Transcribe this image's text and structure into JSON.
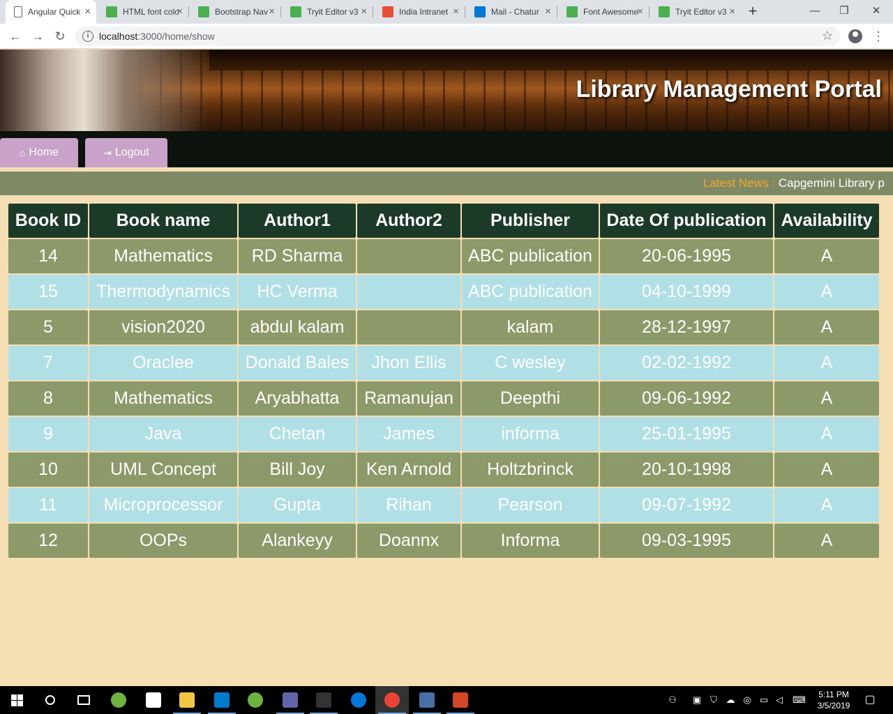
{
  "browser": {
    "tabs": [
      {
        "title": "Angular Quick",
        "icon": "document-icon",
        "color": "#5f6368",
        "active": true
      },
      {
        "title": "HTML font color",
        "icon": "w3schools-icon",
        "color": "#4caf50"
      },
      {
        "title": "Bootstrap Nav",
        "icon": "w3schools-icon",
        "color": "#4caf50"
      },
      {
        "title": "Tryit Editor v3",
        "icon": "w3schools-icon",
        "color": "#4caf50"
      },
      {
        "title": "India Intranet",
        "icon": "t-icon",
        "color": "#e94e36"
      },
      {
        "title": "Mail - Chatur",
        "icon": "outlook-icon",
        "color": "#0078d4"
      },
      {
        "title": "Font Awesome",
        "icon": "w3schools-icon",
        "color": "#4caf50"
      },
      {
        "title": "Tryit Editor v3",
        "icon": "w3schools-icon",
        "color": "#4caf50"
      }
    ],
    "new_tab": "+",
    "minimize": "—",
    "restore": "❐",
    "close": "✕",
    "back": "←",
    "forward": "→",
    "reload": "↻",
    "url_host": "localhost",
    "url_rest": ":3000/home/show"
  },
  "page": {
    "banner_title": "Library Management Portal",
    "nav": {
      "home": "Home",
      "logout": "Logout"
    },
    "news": {
      "label": "Latest News :",
      "text": "Capgemini Library p"
    },
    "table": {
      "headers": [
        "Book ID",
        "Book name",
        "Author1",
        "Author2",
        "Publisher",
        "Date Of publication",
        "Availability"
      ],
      "rows": [
        [
          "14",
          "Mathematics",
          "RD Sharma",
          "",
          "ABC publication",
          "20-06-1995",
          "A"
        ],
        [
          "15",
          "Thermodynamics",
          "HC Verma",
          "",
          "ABC publication",
          "04-10-1999",
          "A"
        ],
        [
          "5",
          "vision2020",
          "abdul kalam",
          "",
          "kalam",
          "28-12-1997",
          "A"
        ],
        [
          "7",
          "Oraclee",
          "Donald Bales",
          "Jhon Ellis",
          "C wesley",
          "02-02-1992",
          "A"
        ],
        [
          "8",
          "Mathematics",
          "Aryabhatta",
          "Ramanujan",
          "Deepthi",
          "09-06-1992",
          "A"
        ],
        [
          "9",
          "Java",
          "Chetan",
          "James",
          "informa",
          "25-01-1995",
          "A"
        ],
        [
          "10",
          "UML Concept",
          "Bill Joy",
          "Ken Arnold",
          "Holtzbrinck",
          "20-10-1998",
          "A"
        ],
        [
          "11",
          "Microprocessor",
          "Gupta",
          "Rihan",
          "Pearson",
          "09-07-1992",
          "A"
        ],
        [
          "12",
          "OOPs",
          "Alankeyy",
          "Doannx",
          "Informa",
          "09-03-1995",
          "A"
        ]
      ]
    }
  },
  "taskbar": {
    "time": "5:11 PM",
    "date": "3/5/2019",
    "apps": [
      {
        "name": "search-icon",
        "color": "#000000"
      },
      {
        "name": "task-view-icon",
        "color": "#000000"
      },
      {
        "name": "eclipse-icon",
        "color": "#6db33f"
      },
      {
        "name": "mail-icon",
        "color": "#ffffff"
      },
      {
        "name": "file-explorer-icon",
        "color": "#f4c542"
      },
      {
        "name": "visual-studio-code-icon",
        "color": "#007acc"
      },
      {
        "name": "spring-tool-icon",
        "color": "#6db33f"
      },
      {
        "name": "teams-icon",
        "color": "#6264a7"
      },
      {
        "name": "command-prompt-icon",
        "color": "#333333"
      },
      {
        "name": "edge-icon",
        "color": "#0078d7"
      },
      {
        "name": "chrome-icon",
        "color": "#ea4335"
      },
      {
        "name": "sql-developer-icon",
        "color": "#4a6ea8"
      },
      {
        "name": "powerpoint-icon",
        "color": "#d24726"
      }
    ]
  }
}
